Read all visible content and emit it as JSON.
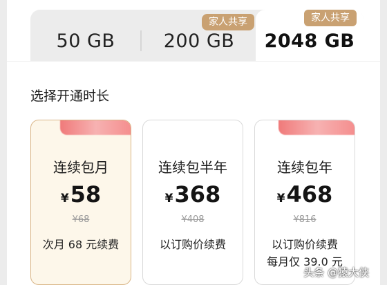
{
  "storage_tabs": [
    {
      "size": "50 GB",
      "badge": ""
    },
    {
      "size": "200 GB",
      "badge": "家人共享"
    },
    {
      "size": "2048 GB",
      "badge": "家人共享"
    }
  ],
  "selected_tab": "2048 GB",
  "section_title": "选择开通时长",
  "plans": [
    {
      "name": "连续包月",
      "currency": "¥",
      "price": "58",
      "original_price": "¥68",
      "renew_line1": "次月 68 元续费",
      "renew_line2": ""
    },
    {
      "name": "连续包半年",
      "currency": "¥",
      "price": "368",
      "original_price": "¥408",
      "renew_line1": "以订购价续费",
      "renew_line2": ""
    },
    {
      "name": "连续包年",
      "currency": "¥",
      "price": "468",
      "original_price": "¥816",
      "renew_line1": "以订购价续费",
      "renew_line2": "每月仅 39.0 元"
    }
  ],
  "watermark": "头条 @猿大侠",
  "colors": {
    "badge": "#c9a172",
    "selected_card_bg": "#fdf7ea",
    "selected_card_border": "#d9b586",
    "promo_tag": "#f07a7a"
  }
}
